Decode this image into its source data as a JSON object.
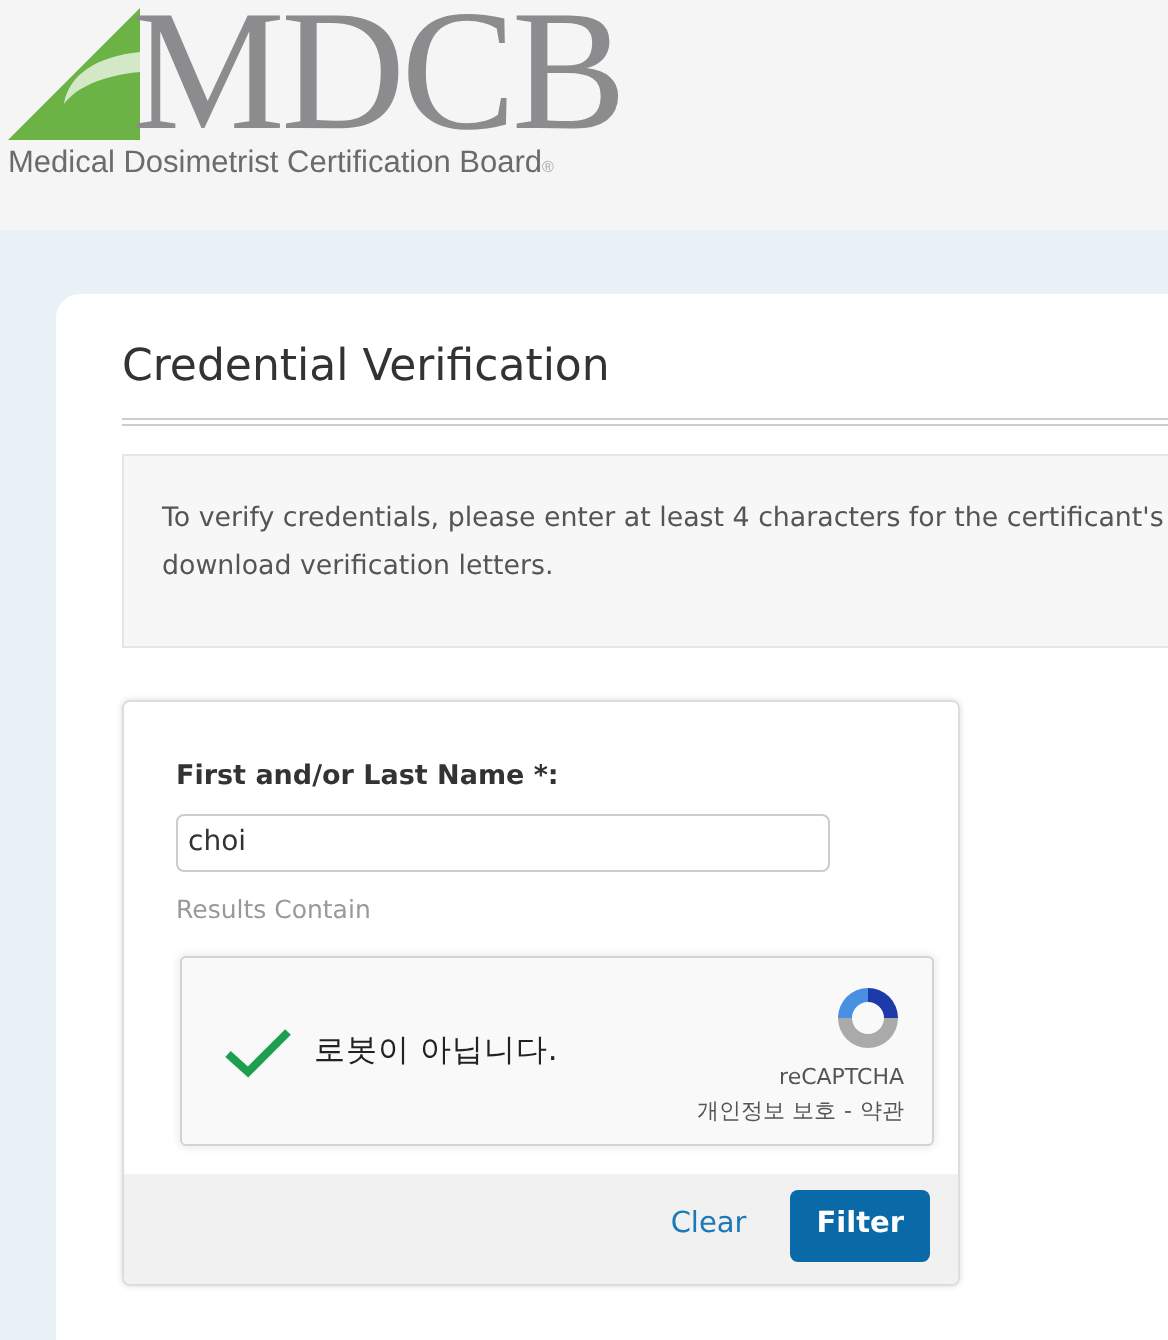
{
  "header": {
    "logo_text": "MDCB",
    "logo_subtitle": "Medical Dosimetrist Certification Board",
    "registered_mark": "®"
  },
  "page_title": "Credential Verification",
  "info_lines": [
    "To verify credentials, please enter at least 4 characters for the certificant's",
    "download verification letters."
  ],
  "form": {
    "label": "First and/or Last Name *:",
    "value": "choi",
    "hint": "Results Contain",
    "captcha": {
      "checked": true,
      "label": "로봇이 아닙니다.",
      "brand": "reCAPTCHA",
      "privacy": "개인정보 보호",
      "separator": "-",
      "terms": "약관"
    },
    "buttons": [
      {
        "label": "Clear",
        "kind": "link"
      },
      {
        "label": "Filter",
        "kind": "primary"
      }
    ]
  }
}
